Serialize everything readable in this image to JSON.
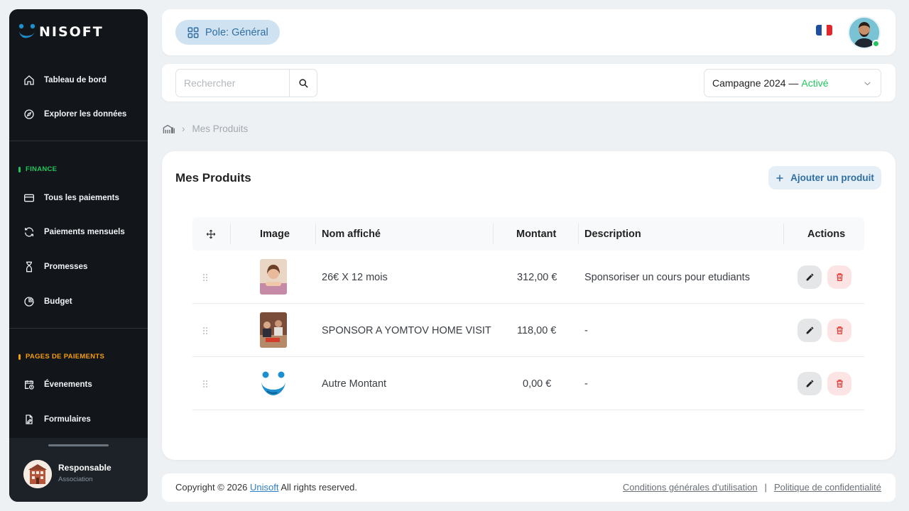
{
  "brand": {
    "name": "NISOFT",
    "accent": "#1d8fce"
  },
  "sidebar": {
    "nav": [
      {
        "label": "Tableau de bord",
        "icon": "home-icon"
      },
      {
        "label": "Explorer les données",
        "icon": "compass-icon"
      }
    ],
    "finance": {
      "title": "FINANCE",
      "color": "#22c55e",
      "items": [
        {
          "label": "Tous les paiements",
          "icon": "card-icon"
        },
        {
          "label": "Paiements mensuels",
          "icon": "refresh-card-icon"
        },
        {
          "label": "Promesses",
          "icon": "hourglass-icon"
        },
        {
          "label": "Budget",
          "icon": "pie-chart-icon"
        }
      ]
    },
    "pages": {
      "title": "PAGES DE PAIEMENTS",
      "color": "#f59e0b",
      "items": [
        {
          "label": "Évenements",
          "icon": "calendar-clock-icon"
        },
        {
          "label": "Formulaires",
          "icon": "form-edit-icon"
        }
      ]
    },
    "profile": {
      "name": "Responsable",
      "role": "Association"
    }
  },
  "header": {
    "pole_label": "Pole: Général",
    "language_icon": "france-flag-icon"
  },
  "search": {
    "placeholder": "Rechercher",
    "value": ""
  },
  "campaign": {
    "name": "Campagne 2024 —",
    "status": "Activé",
    "status_color": "#22c55e"
  },
  "breadcrumb": {
    "home_icon": "building-icon",
    "separator": "›",
    "current": "Mes Produits"
  },
  "main": {
    "title": "Mes Produits",
    "add_button": "Ajouter un produit",
    "columns": {
      "image": "Image",
      "name": "Nom affiché",
      "amount": "Montant",
      "description": "Description",
      "actions": "Actions"
    },
    "rows": [
      {
        "image": "girl-photo",
        "name": "26€ X 12 mois",
        "amount": "312,00 €",
        "description": "Sponsoriser un cours pour etudiants"
      },
      {
        "image": "group-photo",
        "name": "SPONSOR A YOMTOV HOME VISIT",
        "amount": "118,00 €",
        "description": "-"
      },
      {
        "image": "unisoft-logo",
        "name": "Autre Montant",
        "amount": "0,00 €",
        "description": "-"
      }
    ]
  },
  "footer": {
    "copyright": "Copyright © 2026",
    "brand_link": "Unisoft",
    "rights": "All rights reserved.",
    "terms": "Conditions générales d'utilisation",
    "separator": "|",
    "privacy": "Politique de confidentialité"
  }
}
